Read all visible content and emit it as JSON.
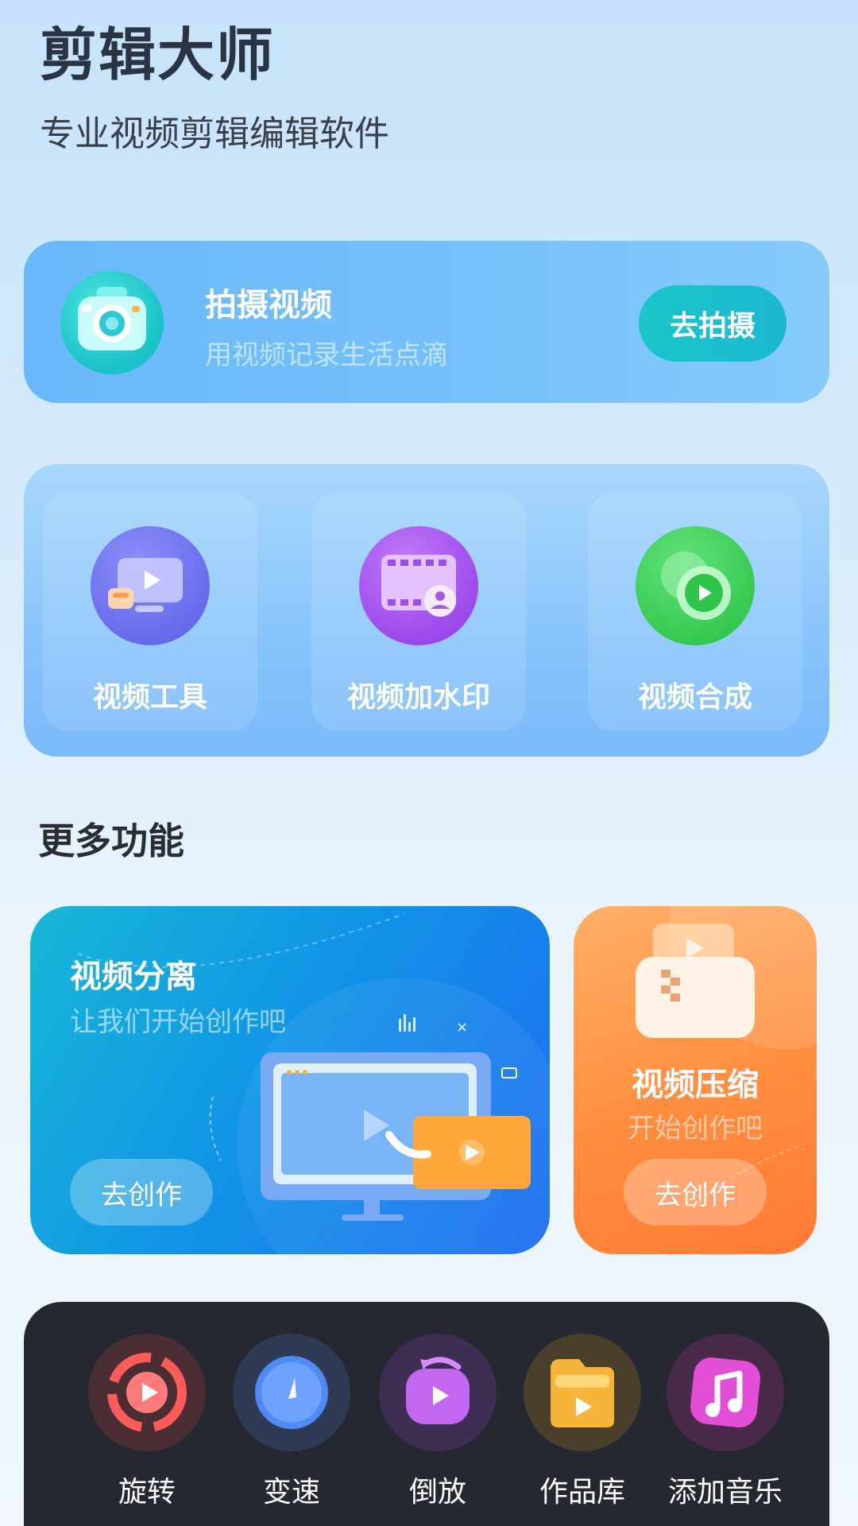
{
  "app": {
    "title": "剪辑大师",
    "subtitle": "专业视频剪辑编辑软件"
  },
  "record": {
    "title": "拍摄视频",
    "subtitle": "用视频记录生活点滴",
    "button": "去拍摄",
    "icon": "camera-icon"
  },
  "tools": [
    {
      "label": "视频工具",
      "icon": "monitor-play-icon",
      "color": "#6a6df0"
    },
    {
      "label": "视频加水印",
      "icon": "film-user-icon",
      "color": "#a34ff0"
    },
    {
      "label": "视频合成",
      "icon": "play-merge-icon",
      "color": "#2fcf55"
    }
  ],
  "more": {
    "title": "更多功能",
    "split": {
      "title": "视频分离",
      "subtitle": "让我们开始创作吧",
      "button": "去创作"
    },
    "compress": {
      "title": "视频压缩",
      "subtitle": "开始创作吧",
      "button": "去创作"
    }
  },
  "dock": [
    {
      "label": "旋转",
      "icon": "rotate-icon",
      "color": "#ff5a5a"
    },
    {
      "label": "变速",
      "icon": "speed-icon",
      "color": "#4f8af7"
    },
    {
      "label": "倒放",
      "icon": "reverse-icon",
      "color": "#b55af2"
    },
    {
      "label": "作品库",
      "icon": "folder-icon",
      "color": "#f6b53a"
    },
    {
      "label": "添加音乐",
      "icon": "music-icon",
      "color": "#e24fd6"
    }
  ],
  "colors": {
    "accent_teal": "#19c6c7",
    "dock_bg": "#252830",
    "title_text": "#2b3443"
  }
}
